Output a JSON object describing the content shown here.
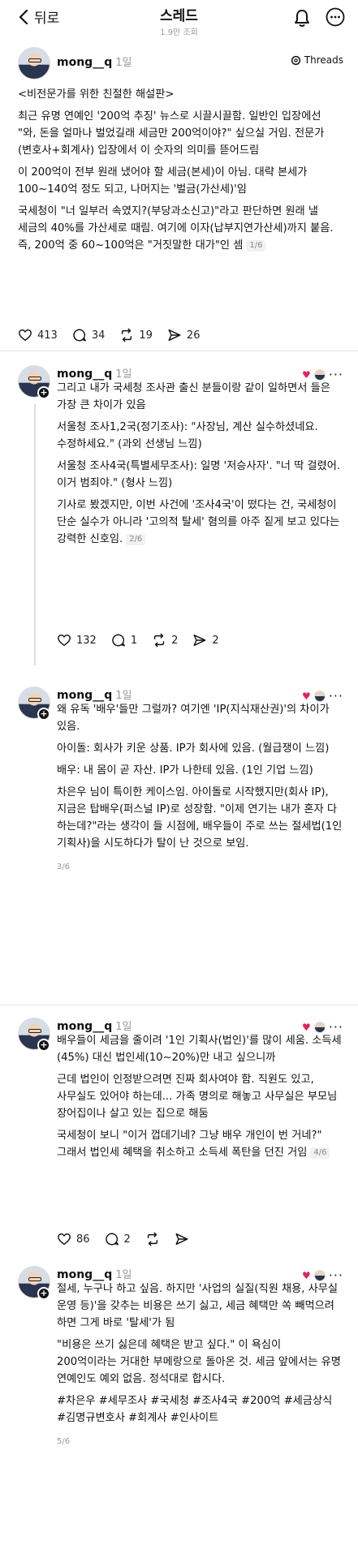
{
  "header": {
    "back_label": "뒤로",
    "title": "스레드",
    "subtitle": "1.9만 조회"
  },
  "posts": [
    {
      "user": "mong__q",
      "time": "1일",
      "badge": "Threads",
      "paragraphs": [
        "<비전문가를 위한 친절한 해설판>",
        "최근 유명 연예인 '200억 추징' 뉴스로 시끌시끌함. 일반인 입장에선 \"와, 돈을 얼마나 벌었길래 세금만 200억이야?\" 싶으실 거임. 전문가(변호사+회계사) 입장에서 이 숫자의 의미를 뜯어드림",
        "이 200억이 전부 원래 냈어야 할 세금(본세)이 아님. 대략 본세가 100~140억 정도 되고, 나머지는 '벌금(가산세)'임",
        "국세청이 \"너 일부러 속였지?(부당과소신고)\"라고 판단하면 원래 낼 세금의 40%를 가산세로 때림. 여기에 이자(납부지연가산세)까지 붙음. 즉, 200억 중 60~100억은 \"거짓말한 대가\"인 셈"
      ],
      "page": "1/6",
      "likes": "413",
      "comments": "34",
      "reposts": "19",
      "shares": "26"
    },
    {
      "user": "mong__q",
      "time": "1일",
      "paragraphs": [
        "그리고 내가 국세청 조사관 출신 분들이랑 같이 일하면서 들은 가장 큰 차이가 있음",
        "서울청 조사1,2국(정기조사): \"사장님, 계산 실수하셨네요. 수정하세요.\" (과외 선생님 느낌)",
        "서울청 조사4국(특별세무조사): 일명 '저승사자'. \"너 딱 걸렸어. 이거 범죄야.\" (형사 느낌)",
        "기사로 봤겠지만, 이번 사건에 '조사4국'이 떴다는 건, 국세청이 단순 실수가 아니라 '고의적 탈세' 혐의를 아주 짙게 보고 있다는 강력한 신호임."
      ],
      "page": "2/6",
      "likes": "132",
      "comments": "1",
      "reposts": "2",
      "shares": "2"
    },
    {
      "user": "mong__q",
      "time": "1일",
      "paragraphs": [
        "왜 유독 '배우'들만 그럴까? 여기엔 'IP(지식재산권)'의 차이가 있음.",
        "아이돌: 회사가 키운 상품. IP가 회사에 있음. (월급쟁이 느낌)",
        "배우: 내 몸이 곧 자산. IP가 나한테 있음. (1인 기업 느낌)",
        "차은우 님이 특이한 케이스임. 아이돌로 시작했지만(회사 IP), 지금은 탑배우(퍼스널 IP)로 성장함. \"이제 연기는 내가 혼자 다 하는데?\"라는 생각이 들 시점에, 배우들이 주로 쓰는 절세법(1인 기획사)을 시도하다가 탈이 난 것으로 보임."
      ],
      "page": "3/6"
    },
    {
      "user": "mong__q",
      "time": "1일",
      "paragraphs": [
        "배우들이 세금을 줄이려 '1인 기획사(법인)'를 많이 세움. 소득세(45%) 대신 법인세(10~20%)만 내고 싶으니까",
        "근데 법인이 인정받으려면 진짜 회사여야 함. 직원도 있고, 사무실도 있어야 하는데... 가족 명의로 해놓고 사무실은 부모님 장어집이나 살고 있는 집으로 해둠",
        "국세청이 보니 \"이거 껍데기네? 그냥 배우 개인이 번 거네?\" 그래서 법인세 혜택을 취소하고 소득세 폭탄을 던진 거임"
      ],
      "page": "4/6",
      "likes": "86",
      "comments": "2"
    },
    {
      "user": "mong__q",
      "time": "1일",
      "paragraphs": [
        "절세, 누구나 하고 싶음. 하지만 '사업의 실질(직원 채용, 사무실 운영 등)'을 갖추는 비용은 쓰기 싫고, 세금 혜택만 쏙 빼먹으려 하면 그게 바로 '탈세'가 됨",
        "\"비용은 쓰기 싫은데 혜택은 받고 싶다.\" 이 욕심이 200억이라는 거대한 부메랑으로 돌아온 것. 세금 앞에서는 유명 연예인도 예외 없음. 정석대로 합시다.",
        "#차은우 #세무조사 #국세청 #조사4국 #200억 #세금상식 #김명규변호사 #회계사 #인사이트"
      ],
      "page": "5/6"
    }
  ]
}
